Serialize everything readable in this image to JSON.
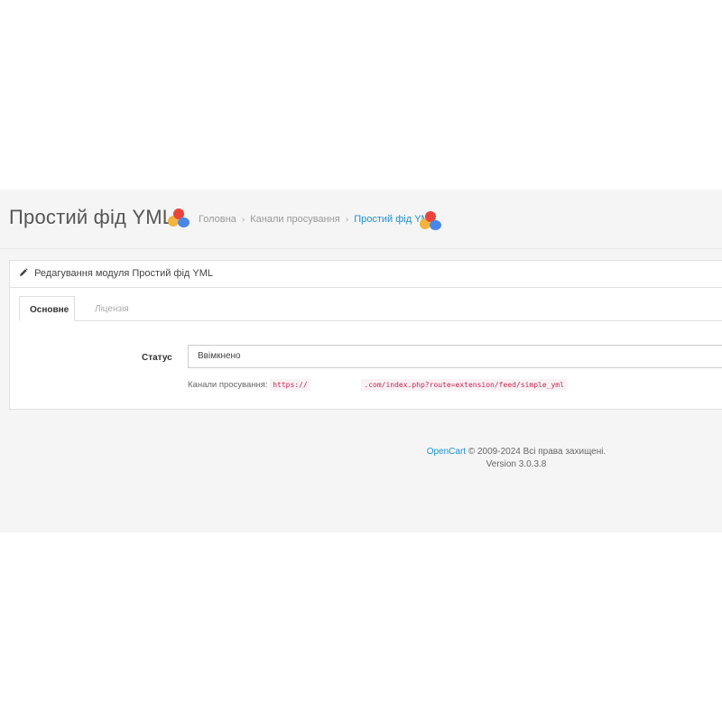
{
  "header": {
    "title": "Простий фід YML",
    "breadcrumb": [
      "Головна",
      "Канали просування",
      "Простий фід YML"
    ],
    "separator": "›"
  },
  "panel": {
    "heading": "Редагування модуля Простий фід YML",
    "tabs": [
      {
        "label": "Основне",
        "active": true
      },
      {
        "label": "Ліцензія",
        "active": false
      }
    ],
    "status_label": "Статус",
    "status_value": "Ввімкнено",
    "feed_label": "Канали просування:",
    "feed_url_prefix": "https://",
    "feed_url_suffix": ".com/index.php?route=extension/feed/simple_yml"
  },
  "footer": {
    "brand": "OpenCart",
    "copyright": "© 2009-2024 Всі права захищені.",
    "version": "Version 3.0.3.8"
  },
  "colors": {
    "link": "#1e91cf",
    "code": "#c7254e",
    "background": "#f5f5f5"
  },
  "icons": {
    "logo": "colorful-blobs-logo",
    "heading": "pencil-icon"
  }
}
